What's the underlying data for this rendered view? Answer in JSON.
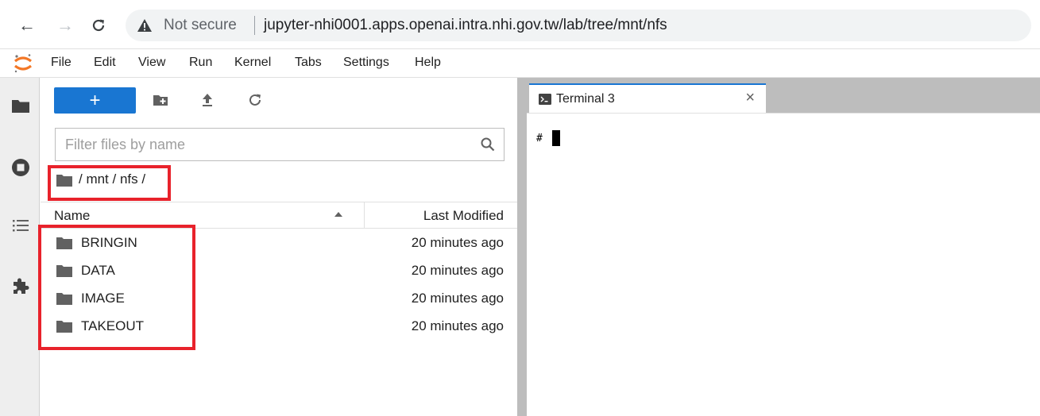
{
  "browser": {
    "security_label": "Not secure",
    "url": "jupyter-nhi0001.apps.openai.intra.nhi.gov.tw/lab/tree/mnt/nfs"
  },
  "menu": {
    "items": [
      {
        "label": "File"
      },
      {
        "label": "Edit"
      },
      {
        "label": "View"
      },
      {
        "label": "Run"
      },
      {
        "label": "Kernel"
      },
      {
        "label": "Tabs"
      },
      {
        "label": "Settings"
      },
      {
        "label": "Help"
      }
    ]
  },
  "filebrowser": {
    "new_button_label": "+",
    "filter_placeholder": "Filter files by name",
    "breadcrumb": "/ mnt / nfs /",
    "columns": {
      "name": "Name",
      "modified": "Last Modified"
    },
    "files": [
      {
        "name": "BRINGIN",
        "modified": "20 minutes ago"
      },
      {
        "name": "DATA",
        "modified": "20 minutes ago"
      },
      {
        "name": "IMAGE",
        "modified": "20 minutes ago"
      },
      {
        "name": "TAKEOUT",
        "modified": "20 minutes ago"
      }
    ]
  },
  "main": {
    "tab_label": "Terminal 3",
    "tab_close": "×",
    "terminal_prompt": "#"
  },
  "colors": {
    "accent": "#1976d2",
    "annotation": "#e8222b"
  }
}
